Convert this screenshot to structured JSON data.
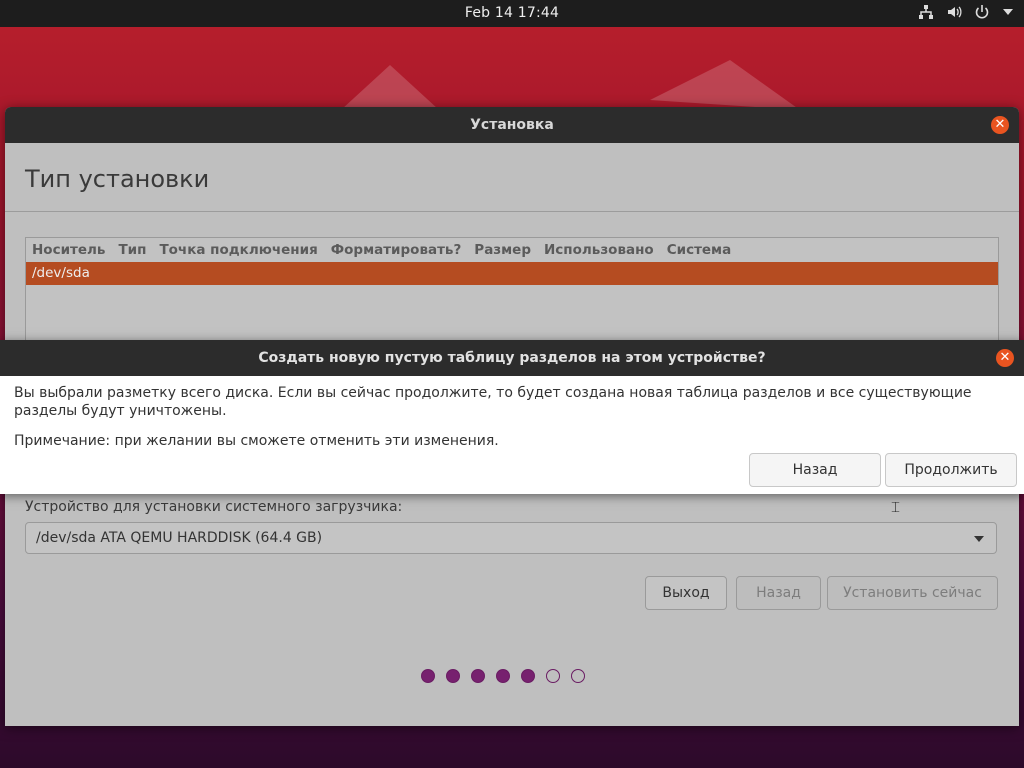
{
  "topbar": {
    "datetime": "Feb 14  17:44",
    "icons": [
      "network-icon",
      "volume-icon",
      "power-icon",
      "menu-down-icon"
    ]
  },
  "window": {
    "title": "Установка",
    "page_title": "Тип установки",
    "table": {
      "columns": [
        "Носитель",
        "Тип",
        "Точка подключения",
        "Форматировать?",
        "Размер",
        "Использовано",
        "Система"
      ],
      "rows": [
        {
          "device": "/dev/sda",
          "selected": true
        }
      ]
    },
    "bootloader": {
      "label": "Устройство для установки системного загрузчика:",
      "selected": "/dev/sda ATA QEMU HARDDISK (64.4 GB)"
    },
    "buttons": {
      "quit": "Выход",
      "back": "Назад",
      "install": "Установить сейчас"
    },
    "progress_dots": {
      "total": 7,
      "filled": 5
    }
  },
  "dialog": {
    "title": "Создать новую пустую таблицу разделов на этом устройстве?",
    "text": "Вы выбрали разметку всего диска. Если вы сейчас продолжите, то будет создана новая таблица разделов и все существующие разделы будут уничтожены.",
    "note": "Примечание: при желании вы сможете отменить эти изменения.",
    "back_label": "Назад",
    "continue_label": "Продолжить"
  },
  "colors": {
    "accent": "#e95420",
    "selected_row": "#b54c21",
    "progress": "#77216f",
    "titlebar": "#2c2c2c"
  }
}
